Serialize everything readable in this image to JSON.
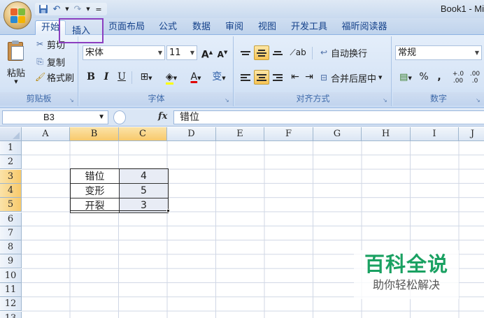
{
  "window": {
    "title": "Book1 - Mi"
  },
  "quick_access": {
    "icons": [
      "save-icon",
      "undo-icon",
      "redo-icon",
      "customize-icon"
    ],
    "undo_glyph": "↶",
    "redo_glyph": "↷",
    "more_glyph": "="
  },
  "ribbon_tabs": [
    "开始",
    "插入",
    "页面布局",
    "公式",
    "数据",
    "审阅",
    "视图",
    "开发工具",
    "福昕阅读器"
  ],
  "clipboard": {
    "paste": "粘贴",
    "cut": "剪切",
    "copy": "复制",
    "format_painter": "格式刷",
    "group_label": "剪贴板"
  },
  "font": {
    "name": "宋体",
    "size": "11",
    "bold": "B",
    "italic": "I",
    "underline": "U",
    "grow": "A",
    "shrink": "A",
    "font_color": "A",
    "phonetic": "变",
    "group_label": "字体"
  },
  "alignment": {
    "wrap_text": "自动换行",
    "merge_center": "合并后居中",
    "group_label": "对齐方式"
  },
  "number": {
    "format": "常规",
    "percent": "%",
    "comma": ",",
    "inc_decimal": "+.0 .00",
    "dec_decimal": ".00 .0",
    "group_label": "数字"
  },
  "formula_bar": {
    "name_box": "B3",
    "fx": "fx",
    "content": "错位"
  },
  "grid": {
    "columns": [
      "A",
      "B",
      "C",
      "D",
      "E",
      "F",
      "G",
      "H",
      "I",
      "J"
    ],
    "selected_columns": [
      "B",
      "C"
    ],
    "rows": [
      "1",
      "2",
      "3",
      "4",
      "5",
      "6",
      "7",
      "8",
      "9",
      "10",
      "11",
      "12",
      "13"
    ],
    "selected_rows": [
      "3",
      "4",
      "5"
    ]
  },
  "table": {
    "rows": [
      {
        "label": "错位",
        "value": "4"
      },
      {
        "label": "变形",
        "value": "5"
      },
      {
        "label": "开裂",
        "value": "3"
      }
    ]
  },
  "watermark": {
    "title": "百科全说",
    "subtitle": "助你轻松解决"
  },
  "colors": {
    "highlight_border": "#8b3fc0",
    "selected_header": "#f8c96b",
    "watermark_green": "#1aa162"
  }
}
